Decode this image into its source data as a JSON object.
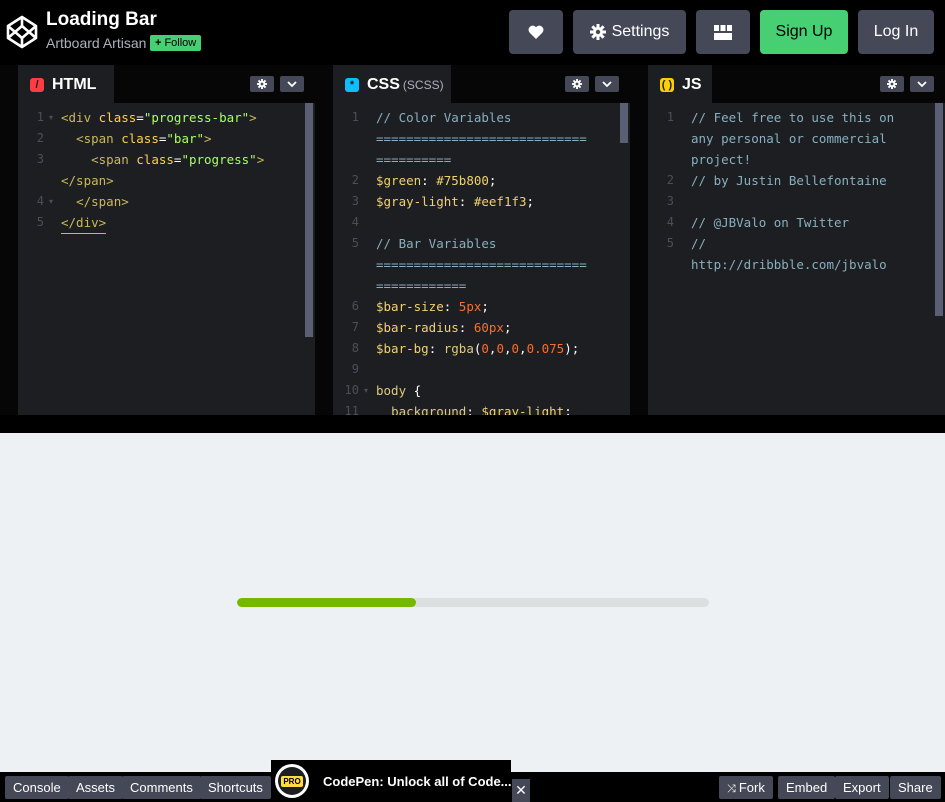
{
  "header": {
    "title": "Loading Bar",
    "author": "Artboard Artisan",
    "follow_label": "Follow",
    "settings_label": "Settings",
    "signup_label": "Sign Up",
    "login_label": "Log In"
  },
  "editors": {
    "html": {
      "label": "HTML",
      "line_numbers": [
        "1",
        "2",
        "3",
        "",
        "4",
        "5"
      ]
    },
    "css": {
      "label": "CSS",
      "sub": "(SCSS)",
      "line_numbers": [
        "1",
        "",
        "",
        "2",
        "3",
        "4",
        "5",
        "",
        "",
        "6",
        "7",
        "8",
        "9",
        "10",
        "11"
      ]
    },
    "js": {
      "label": "JS",
      "line_numbers": [
        "1",
        "",
        "",
        "2",
        "3",
        "4",
        "5",
        ""
      ],
      "lines": [
        "// Feel free to use this on",
        "any personal or commercial",
        "project!",
        "// by Justin Bellefontaine",
        "",
        "// @JBValo on Twitter",
        "//",
        "http://dribbble.com/jbvalo"
      ]
    }
  },
  "preview": {
    "progress": 0.38,
    "bar_color": "#75b800",
    "background": "#eef1f3"
  },
  "footer": {
    "console": "Console",
    "assets": "Assets",
    "comments": "Comments",
    "shortcuts": "Shortcuts",
    "promo_badge": "PRO",
    "promo_text": "CodePen: Unlock all of Code...",
    "close": "✕",
    "fork": "Fork",
    "embed": "Embed",
    "export": "Export",
    "share": "Share"
  },
  "colors": {
    "accent_green": "#47cf73",
    "button_gray": "#444857",
    "html_icon": "#ff3c41",
    "css_icon": "#0ebeff",
    "js_icon": "#fcd000"
  },
  "icons": [
    "codepen-logo-icon",
    "heart-icon",
    "gear-icon",
    "layout-icon",
    "gear-icon",
    "chevron-down-icon",
    "fork-icon",
    "close-icon"
  ]
}
